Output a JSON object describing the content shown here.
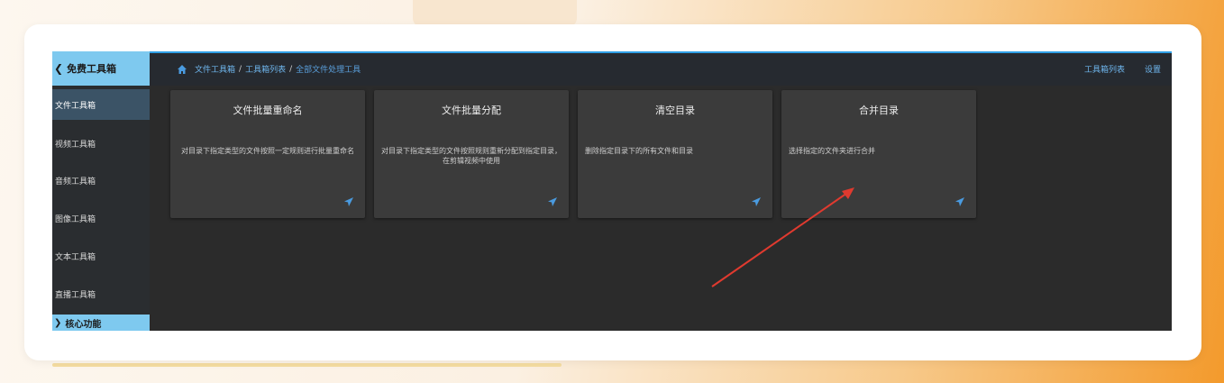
{
  "sidebar": {
    "header": "免费工具箱",
    "items": [
      {
        "label": "文件工具箱",
        "active": true
      },
      {
        "label": "视频工具箱",
        "active": false
      },
      {
        "label": "音频工具箱",
        "active": false
      },
      {
        "label": "图像工具箱",
        "active": false
      },
      {
        "label": "文本工具箱",
        "active": false
      },
      {
        "label": "直播工具箱",
        "active": false
      }
    ],
    "bottom": "核心功能"
  },
  "breadcrumb": [
    "文件工具箱",
    "工具箱列表",
    "全部文件处理工具"
  ],
  "top_links": [
    "工具箱列表",
    "设置"
  ],
  "tools": [
    {
      "title": "文件批量重命名",
      "desc": "对目录下指定类型的文件按照一定规则进行批量重命名",
      "align": "center"
    },
    {
      "title": "文件批量分配",
      "desc": "对目录下指定类型的文件按照规则重新分配到指定目录，在剪辑视频中使用",
      "align": "center"
    },
    {
      "title": "清空目录",
      "desc": "删除指定目录下的所有文件和目录",
      "align": "left"
    },
    {
      "title": "合并目录",
      "desc": "选择指定的文件夹进行合并",
      "align": "left"
    }
  ],
  "colors": {
    "accent": "#6fb6ee",
    "sidebar_header_bg": "#7ec9ef",
    "annotation_arrow": "#e03a2f"
  }
}
